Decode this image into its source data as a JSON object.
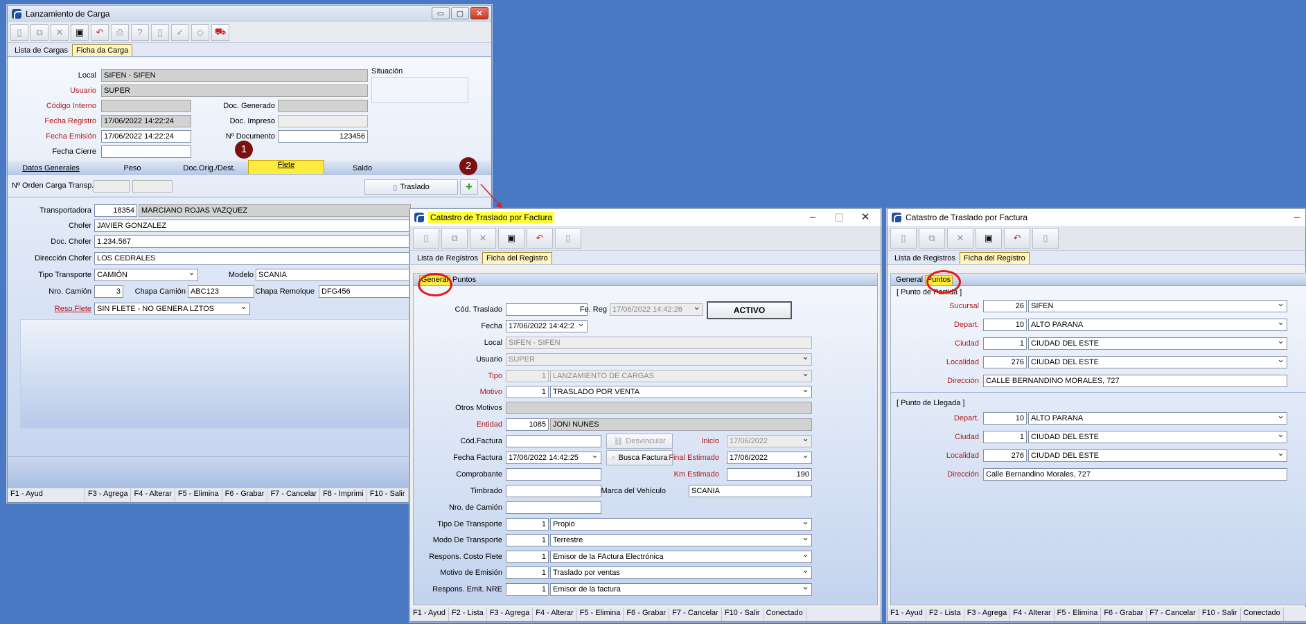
{
  "win1": {
    "title": "Lanzamiento de Carga",
    "tabs": [
      "Lista de Cargas",
      "Ficha da Carga"
    ],
    "labels": {
      "local": "Local",
      "usuario": "Usuario",
      "codigo": "Código Interno",
      "fecha_reg": "Fecha Registro",
      "fecha_emi": "Fecha Emisión",
      "fecha_cierre": "Fecha Cierre",
      "doc_gen": "Doc. Generado",
      "doc_imp": "Doc. Impreso",
      "ndoc": "Nº Documento",
      "situacion": "Situación"
    },
    "values": {
      "local": "SIFEN - SIFEN",
      "usuario": "SUPER",
      "fecha_reg": "17/06/2022 14:22:24",
      "fecha_emi": "17/06/2022 14:22:24",
      "ndoc": "123456"
    },
    "subtabs": [
      "Datos Generales",
      "Peso",
      "Doc.Orig./Dest.",
      "Flete",
      "Saldo"
    ],
    "orden_label": "Nº Orden Carga Transp.",
    "traslado_button": "Traslado",
    "add_icon": "+",
    "flete": {
      "transportadora_label": "Transportadora",
      "transportadora_code": "18354",
      "transportadora_name": "MARCIANO ROJAS VAZQUEZ",
      "chofer_label": "Chofer",
      "chofer": "JAVIER GONZALEZ",
      "doc_chofer_label": "Doc. Chofer",
      "doc_chofer": "1.234.567",
      "dir_chofer_label": "Dirección Chofer",
      "dir_chofer": "LOS CEDRALES",
      "tipo_transp_label": "Tipo Transporte",
      "tipo_transp": "CAMIÓN",
      "modelo_label": "Modelo",
      "modelo": "SCANIA",
      "nro_camion_label": "Nro. Camión",
      "nro_camion": "3",
      "chapa_camion_label": "Chapa Camión",
      "chapa_camion": "ABC123",
      "chapa_remolque_label": "Chapa Remolque",
      "chapa_remolque": "DFG456",
      "resp_flete_label": "Resp.Flete",
      "resp_flete": "SIN FLETE - NO GENERA LZTOS"
    },
    "status": [
      "F1 - Ayud",
      "F3 - Agrega",
      "F4 - Alterar",
      "F5 - Elimina",
      "F6 - Grabar",
      "F7 - Cancelar",
      "F8 - Imprimi",
      "F10 - Salir"
    ]
  },
  "badges": {
    "one": "1",
    "two": "2"
  },
  "win2": {
    "title": "Catastro de Traslado por Factura",
    "tabs": [
      "Lista de Registros",
      "Ficha del Registro"
    ],
    "subtabs": [
      "General",
      "Puntos"
    ],
    "estado": "ACTIVO",
    "labels": {
      "cod": "Cód. Traslado",
      "fereg": "Fe. Reg",
      "fecha": "Fecha",
      "local": "Local",
      "usuario": "Usuario",
      "tipo": "Tipo",
      "motivo": "Motivo",
      "otros": "Otros Motivos",
      "entidad": "Entidad",
      "codfact": "Cód.Factura",
      "desvincular": "Desvincular",
      "inicio": "Inicio",
      "fechafact": "Fecha Factura",
      "busca": "Busca Factura",
      "finalest": "Final Estimado",
      "comprobante": "Comprobante",
      "kmest": "Km Estimado",
      "timbrado": "Timbrado",
      "marca": "Marca del Vehículo",
      "nrocamion": "Nro. de Camión",
      "tipotransp": "Tipo De Transporte",
      "modotransp": "Modo De Transporte",
      "respcosto": "Respons. Costo Flete",
      "motivoemi": "Motivo de Emisión",
      "respemit": "Respons. Emit. NRE"
    },
    "values": {
      "fereg": "17/06/2022 14:42:26",
      "fecha": "17/06/2022 14:42:2",
      "local": "SIFEN - SIFEN",
      "usuario": "SUPER",
      "tipo_code": "1",
      "tipo": "LANZAMIENTO DE CARGAS",
      "motivo_code": "1",
      "motivo": "TRASLADO POR VENTA",
      "entidad_code": "1085",
      "entidad": "JONI NUNES",
      "inicio": "17/06/2022",
      "fechafact": "17/06/2022 14:42:25",
      "finalest": "17/06/2022",
      "kmest": "190",
      "marca": "SCANIA",
      "tipotransp_code": "1",
      "tipotransp": "Propio",
      "modotransp_code": "1",
      "modotransp": "Terrestre",
      "respcosto_code": "1",
      "respcosto": "Emisor de la FActura Electrónica",
      "motivoemi_code": "1",
      "motivoemi": "Traslado por ventas",
      "respemit_code": "1",
      "respemit": "Emisor de la factura"
    },
    "status": [
      "F1 - Ayud",
      "F2 - Lista",
      "F3 - Agrega",
      "F4 - Alterar",
      "F5 - Elimina",
      "F6 - Grabar",
      "F7 - Cancelar",
      "F10 - Salir",
      "Conectado"
    ]
  },
  "win3": {
    "title": "Catastro de Traslado por Factura",
    "tabs": [
      "Lista de Registros",
      "Ficha del Registro"
    ],
    "subtabs": [
      "General",
      "Puntos"
    ],
    "grp_partida": "[ Punto de Partida ]",
    "grp_llegada": "[ Punto de Llegada ]",
    "partida": {
      "sucursal_label": "Sucursal",
      "sucursal_code": "26",
      "sucursal": "SIFEN",
      "depart_label": "Depart.",
      "depart_code": "10",
      "depart": "ALTO PARANA",
      "ciudad_label": "Ciudad",
      "ciudad_code": "1",
      "ciudad": "CIUDAD DEL ESTE",
      "localidad_label": "Localidad",
      "localidad_code": "276",
      "localidad": "CIUDAD DEL ESTE",
      "direccion_label": "Dirección",
      "direccion": "CALLE BERNANDINO MORALES, 727"
    },
    "llegada": {
      "depart_label": "Depart.",
      "depart_code": "10",
      "depart": "ALTO PARANA",
      "ciudad_label": "Ciudad",
      "ciudad_code": "1",
      "ciudad": "CIUDAD DEL ESTE",
      "localidad_label": "Localidad",
      "localidad_code": "276",
      "localidad": "CIUDAD DEL ESTE",
      "direccion_label": "Dirección",
      "direccion": "Calle Bernandino Morales, 727"
    },
    "status": [
      "F1 - Ayud",
      "F2 - Lista",
      "F3 - Agrega",
      "F4 - Alterar",
      "F5 - Elimina",
      "F6 - Grabar",
      "F7 - Cancelar",
      "F10 - Salir",
      "Conectado"
    ]
  }
}
